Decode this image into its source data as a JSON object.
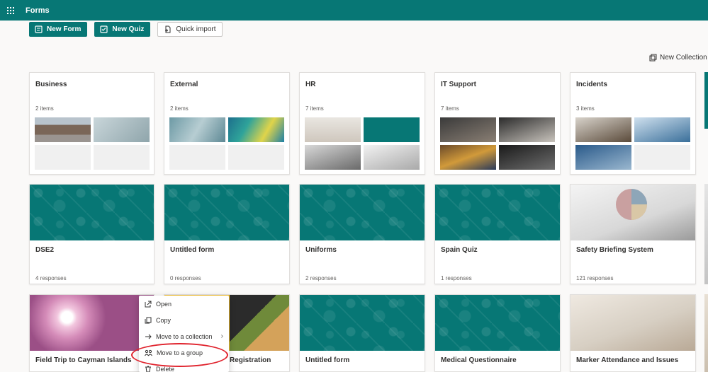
{
  "app": {
    "title": "Forms"
  },
  "toolbar": {
    "new_form": "New Form",
    "new_quiz": "New Quiz",
    "quick_import": "Quick import"
  },
  "new_collection": "New Collection",
  "collections": [
    {
      "name": "Business",
      "count": "2 items"
    },
    {
      "name": "External",
      "count": "2 items"
    },
    {
      "name": "HR",
      "count": "7 items"
    },
    {
      "name": "IT Support",
      "count": "7 items"
    },
    {
      "name": "Incidents",
      "count": "3 items"
    }
  ],
  "forms_row1": [
    {
      "name": "DSE2",
      "responses": "4 responses"
    },
    {
      "name": "Untitled form",
      "responses": "0 responses"
    },
    {
      "name": "Uniforms",
      "responses": "2 responses"
    },
    {
      "name": "Spain Quiz",
      "responses": "1 responses"
    },
    {
      "name": "Safety Briefing System",
      "responses": "121 responses"
    }
  ],
  "forms_row2": [
    {
      "name": "Field Trip to Cayman Islands"
    },
    {
      "name": "Registration"
    },
    {
      "name": "Untitled form"
    },
    {
      "name": "Medical Questionnaire"
    },
    {
      "name": "Marker Attendance and Issues"
    }
  ],
  "context_menu": {
    "open": "Open",
    "copy": "Copy",
    "move_collection": "Move to a collection",
    "move_group": "Move to a group",
    "delete": "Delete"
  },
  "colors": {
    "brand": "#077775",
    "highlight": "#e0242e"
  }
}
